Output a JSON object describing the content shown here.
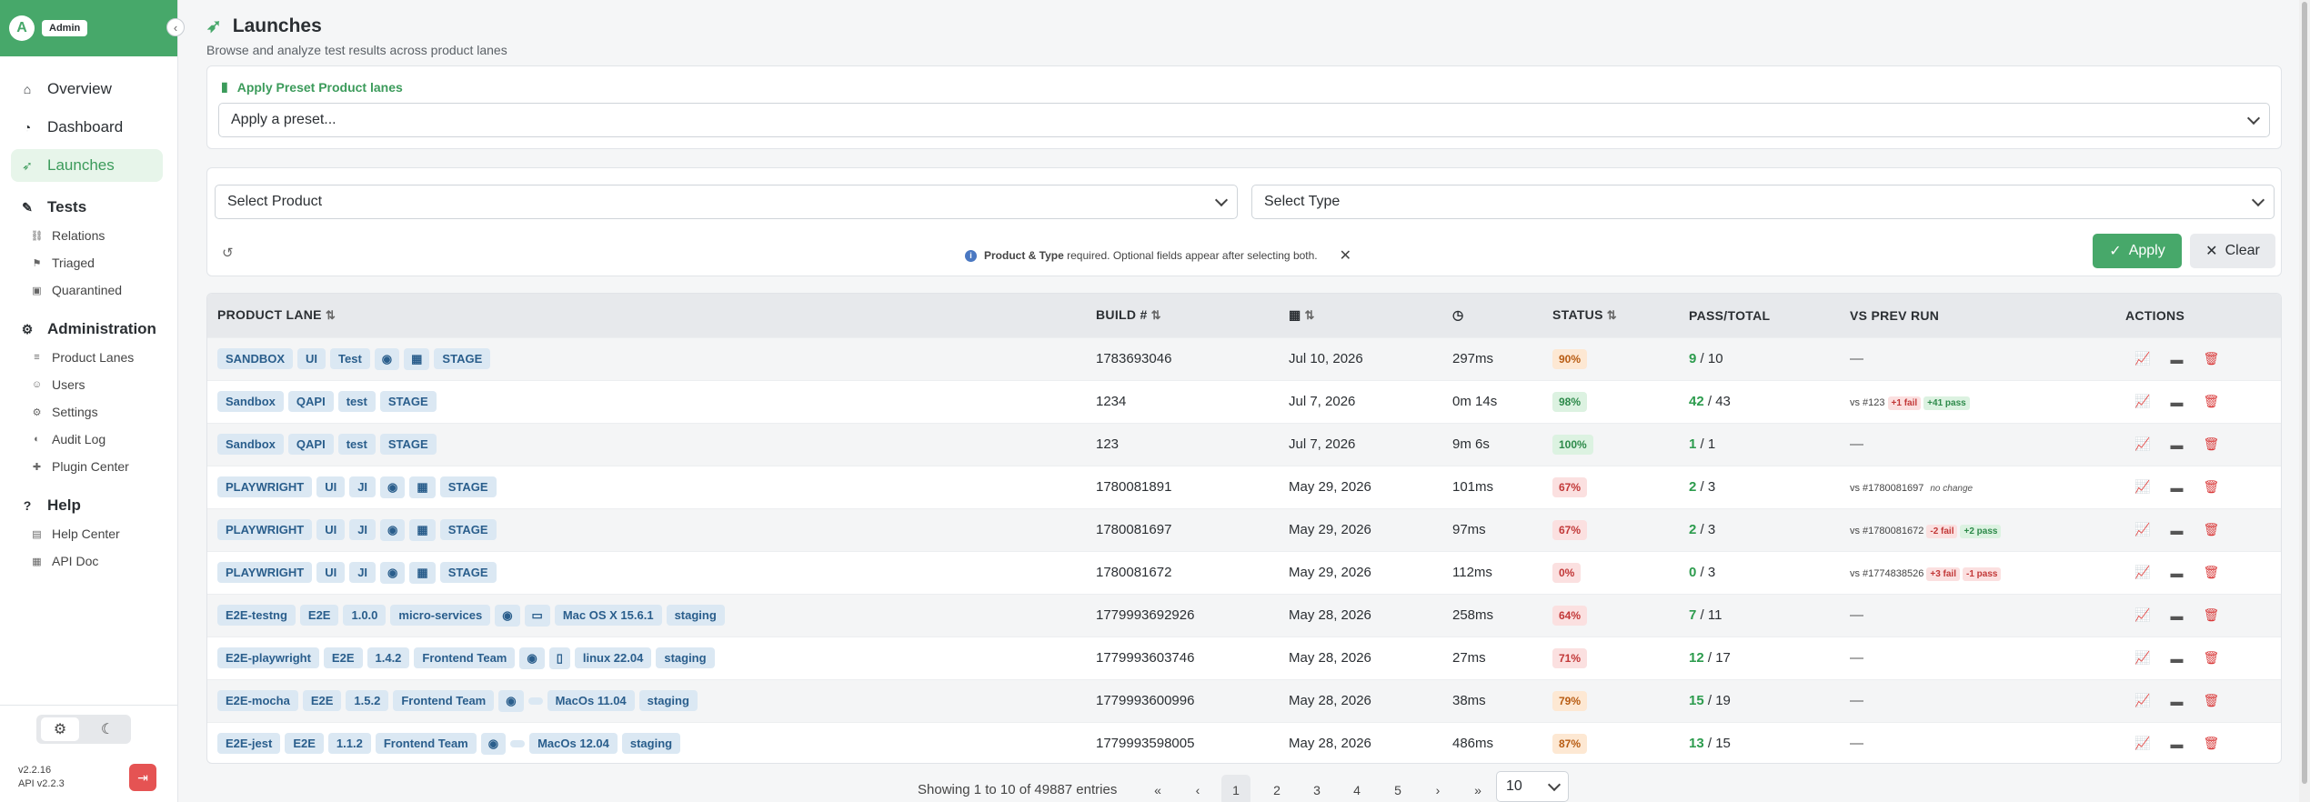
{
  "sidebar": {
    "avatar_letter": "A",
    "role": "Admin",
    "collapse_icon": "‹",
    "nav": [
      {
        "label": "Overview",
        "icon": "⌂",
        "active": false
      },
      {
        "label": "Dashboard",
        "icon": "◔",
        "active": false
      },
      {
        "label": "Launches",
        "icon": "🚀",
        "active": true
      }
    ],
    "tests": {
      "title": "Tests",
      "items": [
        {
          "label": "Relations",
          "icon": "⛓"
        },
        {
          "label": "Triaged",
          "icon": "⚑"
        },
        {
          "label": "Quarantined",
          "icon": "🔒"
        }
      ]
    },
    "admin": {
      "title": "Administration",
      "items": [
        {
          "label": "Product Lanes",
          "icon": "≡"
        },
        {
          "label": "Users",
          "icon": "👥"
        },
        {
          "label": "Settings",
          "icon": "⚙"
        },
        {
          "label": "Audit Log",
          "icon": "◐"
        },
        {
          "label": "Plugin Center",
          "icon": "✚"
        }
      ]
    },
    "help": {
      "title": "Help",
      "items": [
        {
          "label": "Help Center",
          "icon": "▤"
        },
        {
          "label": "API Doc",
          "icon": "▦"
        }
      ]
    },
    "version": "v2.2.16",
    "api_version": "API v2.2.3"
  },
  "header": {
    "title": "Launches",
    "subtitle": "Browse and analyze test results across product lanes"
  },
  "preset": {
    "label": "Apply Preset Product lanes",
    "placeholder": "Apply a preset..."
  },
  "filters": {
    "product_placeholder": "Select Product",
    "type_placeholder": "Select Type",
    "hint_bold": "Product & Type",
    "hint_text": " required. Optional fields appear after selecting both.",
    "apply_label": "Apply",
    "clear_label": "Clear"
  },
  "table": {
    "headers": {
      "product_lane": "PRODUCT LANE",
      "build": "BUILD #",
      "status": "STATUS",
      "pass_total": "PASS/TOTAL",
      "vs_prev": "VS PREV RUN",
      "actions": "ACTIONS"
    },
    "rows": [
      {
        "tags": [
          "SANDBOX",
          "UI",
          "Test",
          "◉",
          "▦",
          "STAGE"
        ],
        "build": "1783693046",
        "date": "Jul 10, 2026",
        "duration": "297ms",
        "status": "90%",
        "status_color": "orange",
        "pass": "9",
        "total": "10",
        "vs": {
          "type": "none",
          "text": "—"
        }
      },
      {
        "tags": [
          "Sandbox",
          "QAPI",
          "test",
          "STAGE"
        ],
        "build": "1234",
        "date": "Jul 7, 2026",
        "duration": "0m 14s",
        "status": "98%",
        "status_color": "green",
        "pass": "42",
        "total": "43",
        "vs": {
          "type": "chips",
          "ref": "vs #123",
          "fail": "+1 fail",
          "passc": "+41 pass"
        }
      },
      {
        "tags": [
          "Sandbox",
          "QAPI",
          "test",
          "STAGE"
        ],
        "build": "123",
        "date": "Jul 7, 2026",
        "duration": "9m 6s",
        "status": "100%",
        "status_color": "green",
        "pass": "1",
        "total": "1",
        "vs": {
          "type": "none",
          "text": "—"
        }
      },
      {
        "tags": [
          "PLAYWRIGHT",
          "UI",
          "JI",
          "◉",
          "▦",
          "STAGE"
        ],
        "build": "1780081891",
        "date": "May 29, 2026",
        "duration": "101ms",
        "status": "67%",
        "status_color": "red",
        "pass": "2",
        "total": "3",
        "vs": {
          "type": "nochange",
          "ref": "vs #1780081697",
          "text": "no change"
        }
      },
      {
        "tags": [
          "PLAYWRIGHT",
          "UI",
          "JI",
          "◉",
          "▦",
          "STAGE"
        ],
        "build": "1780081697",
        "date": "May 29, 2026",
        "duration": "97ms",
        "status": "67%",
        "status_color": "red",
        "pass": "2",
        "total": "3",
        "vs": {
          "type": "chips",
          "ref": "vs #1780081672",
          "fail": "-2 fail",
          "passc": "+2 pass"
        }
      },
      {
        "tags": [
          "PLAYWRIGHT",
          "UI",
          "JI",
          "◉",
          "▦",
          "STAGE"
        ],
        "build": "1780081672",
        "date": "May 29, 2026",
        "duration": "112ms",
        "status": "0%",
        "status_color": "red",
        "pass": "0",
        "total": "3",
        "vs": {
          "type": "chips2",
          "ref": "vs #1774838526",
          "fail": "+3 fail",
          "passc": "-1 pass"
        }
      },
      {
        "tags": [
          "E2E-testng",
          "E2E",
          "1.0.0",
          "micro-services",
          "◉",
          "▭",
          "Mac OS X 15.6.1",
          "staging"
        ],
        "build": "1779993692926",
        "date": "May 28, 2026",
        "duration": "258ms",
        "status": "64%",
        "status_color": "red",
        "pass": "7",
        "total": "11",
        "vs": {
          "type": "none",
          "text": "—"
        }
      },
      {
        "tags": [
          "E2E-playwright",
          "E2E",
          "1.4.2",
          "Frontend Team",
          "◉",
          "▯",
          "linux 22.04",
          "staging"
        ],
        "build": "1779993603746",
        "date": "May 28, 2026",
        "duration": "27ms",
        "status": "71%",
        "status_color": "red",
        "pass": "12",
        "total": "17",
        "vs": {
          "type": "none",
          "text": "—"
        }
      },
      {
        "tags": [
          "E2E-mocha",
          "E2E",
          "1.5.2",
          "Frontend Team",
          "◉",
          "",
          "MacOs 11.04",
          "staging"
        ],
        "build": "1779993600996",
        "date": "May 28, 2026",
        "duration": "38ms",
        "status": "79%",
        "status_color": "orange",
        "pass": "15",
        "total": "19",
        "vs": {
          "type": "none",
          "text": "—"
        }
      },
      {
        "tags": [
          "E2E-jest",
          "E2E",
          "1.1.2",
          "Frontend Team",
          "◉",
          "",
          "MacOs 12.04",
          "staging"
        ],
        "build": "1779993598005",
        "date": "May 28, 2026",
        "duration": "486ms",
        "status": "87%",
        "status_color": "orange",
        "pass": "13",
        "total": "15",
        "vs": {
          "type": "none",
          "text": "—"
        }
      }
    ]
  },
  "pagination": {
    "showing": "Showing 1 to 10 of 49887 entries",
    "first": "«",
    "prev": "‹",
    "pages": [
      "1",
      "2",
      "3",
      "4",
      "5"
    ],
    "active_page": "1",
    "next": "›",
    "last": "»",
    "page_size": "10"
  },
  "colors": {
    "brand": "#47a86a",
    "danger": "#e55353",
    "tag_bg": "#dbe8f3",
    "tag_fg": "#2a5e8c"
  }
}
